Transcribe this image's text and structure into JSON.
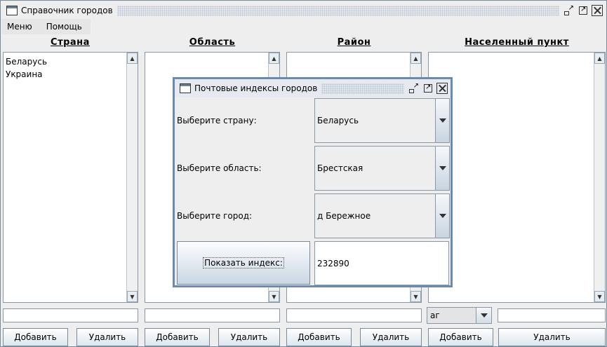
{
  "window": {
    "title": "Справочник городов"
  },
  "menu": {
    "items": [
      "Меню",
      "Помощь"
    ]
  },
  "columns": [
    {
      "header": "Страна",
      "items": [
        "Беларусь",
        "Украина"
      ],
      "input": "",
      "add": "Добавить",
      "remove": "Удалить"
    },
    {
      "header": "Область",
      "items": [],
      "input": "",
      "add": "Добавить",
      "remove": "Удалить"
    },
    {
      "header": "Район",
      "items": [],
      "input": "",
      "add": "Добавить",
      "remove": "Удалить"
    },
    {
      "header": "Населенный пункт",
      "items": [],
      "combo_value": "аг",
      "input": "",
      "add": "Добавить",
      "remove": "Удалить"
    }
  ],
  "dialog": {
    "title": "Почтовые индексы городов",
    "country_label": "Выберите страну:",
    "country_value": "Беларусь",
    "region_label": "Выберите область:",
    "region_value": "Брестская",
    "city_label": "Выберите город:",
    "city_value": "д Бережное",
    "show_button": "Показать индекс:",
    "index_value": "232890"
  },
  "icons": {
    "window": "window-icon",
    "iconify": "iconify-icon",
    "maximize": "maximize-icon",
    "close": "close-icon",
    "dropdown": "chevron-down-icon",
    "scroll_up": "scroll-up-icon",
    "scroll_down": "scroll-down-icon"
  },
  "colors": {
    "dialog_border": "#6a8ab0",
    "background": "#eeeeee"
  }
}
